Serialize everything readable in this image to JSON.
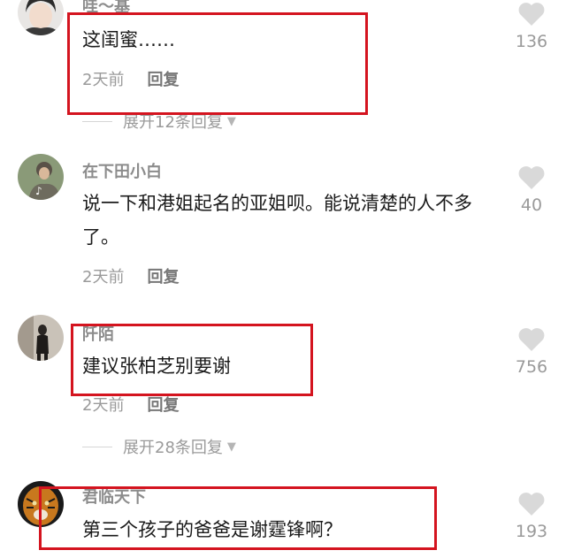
{
  "comments": [
    {
      "username": "哇～基",
      "content": "这闺蜜……",
      "time": "2天前",
      "reply_label": "回复",
      "likes": "136",
      "expand_label": "展开12条回复"
    },
    {
      "username": "在下田小白",
      "content": "说一下和港姐起名的亚姐呗。能说清楚的人不多了。",
      "time": "2天前",
      "reply_label": "回复",
      "likes": "40"
    },
    {
      "username": "阡陌",
      "content": "建议张柏芝别要谢",
      "time": "2天前",
      "reply_label": "回复",
      "likes": "756",
      "expand_label": "展开28条回复"
    },
    {
      "username": "君临天下",
      "content": "第三个孩子的爸爸是谢霆锋啊？",
      "likes": "193"
    }
  ],
  "colors": {
    "highlight_box": "#d4141f",
    "heart": "#d9d9d9",
    "meta_text": "#9a9a9a"
  },
  "icons": {
    "like": "heart-icon",
    "expand": "triangle-down-icon"
  }
}
